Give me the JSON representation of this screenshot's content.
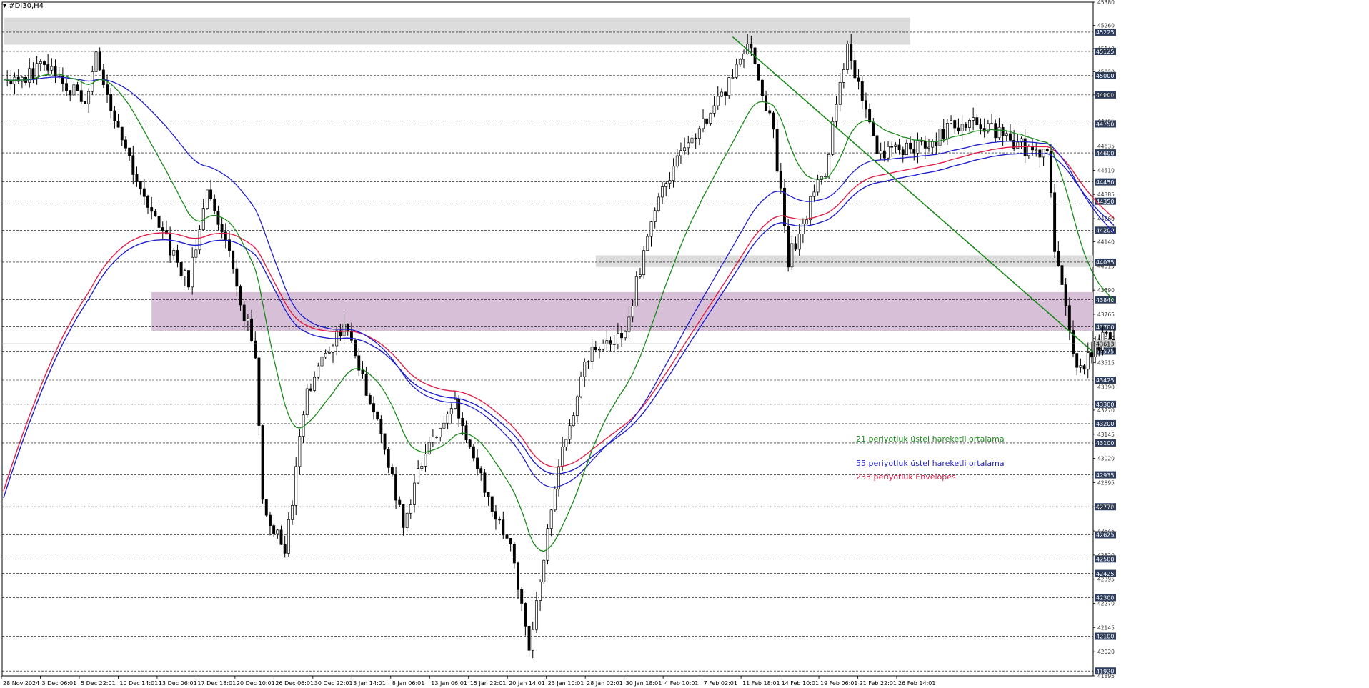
{
  "chart_data": {
    "type": "candlestick",
    "symbol_label": "#DJ30,H4",
    "current_price_label": "43613",
    "y_axis": {
      "min": 41895,
      "max": 45380,
      "tick_labels": [
        "45380",
        "45260",
        "45140",
        "45020",
        "44900",
        "44765",
        "44635",
        "44510",
        "44385",
        "44260",
        "44140",
        "44015",
        "43890",
        "43765",
        "43640",
        "43515",
        "43390",
        "43270",
        "43145",
        "43020",
        "42895",
        "42770",
        "42645",
        "42520",
        "42395",
        "42270",
        "42145",
        "42020",
        "41895"
      ]
    },
    "level_labels": [
      "45225",
      "45125",
      "45000",
      "44900",
      "44750",
      "44600",
      "44450",
      "44350",
      "44200",
      "44035",
      "43840",
      "43700",
      "43575",
      "43425",
      "43300",
      "43200",
      "43100",
      "42935",
      "42770",
      "42625",
      "42500",
      "42425",
      "42300",
      "42100",
      "41920"
    ],
    "x_axis": {
      "tick_labels": [
        "28 Nov 2024",
        "3 Dec 06:01",
        "5 Dec 22:01",
        "10 Dec 14:01",
        "13 Dec 06:01",
        "17 Dec 18:01",
        "20 Dec 10:01",
        "26 Dec 06:01",
        "30 Dec 22:01",
        "3 Jan 14:01",
        "8 Jan 06:01",
        "13 Jan 06:01",
        "15 Jan 22:01",
        "20 Jan 14:01",
        "23 Jan 10:01",
        "28 Jan 02:01",
        "30 Jan 18:01",
        "4 Feb 10:01",
        "7 Feb 02:01",
        "11 Feb 18:01",
        "14 Feb 10:01",
        "19 Feb 06:01",
        "21 Feb 22:01",
        "26 Feb 14:01"
      ]
    },
    "candle_count": 300,
    "price_path_anchors": [
      [
        0,
        44950
      ],
      [
        12,
        45060
      ],
      [
        22,
        44860
      ],
      [
        25,
        45120
      ],
      [
        30,
        44760
      ],
      [
        40,
        44300
      ],
      [
        50,
        43920
      ],
      [
        55,
        44450
      ],
      [
        60,
        44150
      ],
      [
        68,
        43550
      ],
      [
        70,
        42780
      ],
      [
        76,
        42520
      ],
      [
        82,
        43380
      ],
      [
        92,
        43700
      ],
      [
        100,
        43280
      ],
      [
        108,
        42700
      ],
      [
        115,
        43100
      ],
      [
        122,
        43300
      ],
      [
        130,
        42850
      ],
      [
        138,
        42500
      ],
      [
        142,
        42000
      ],
      [
        150,
        43000
      ],
      [
        158,
        43550
      ],
      [
        168,
        43700
      ],
      [
        178,
        44450
      ],
      [
        188,
        44700
      ],
      [
        202,
        45180
      ],
      [
        208,
        44700
      ],
      [
        212,
        44050
      ],
      [
        222,
        44520
      ],
      [
        228,
        45150
      ],
      [
        236,
        44600
      ],
      [
        250,
        44650
      ],
      [
        262,
        44800
      ],
      [
        272,
        44650
      ],
      [
        282,
        44600
      ],
      [
        284,
        44130
      ],
      [
        290,
        43480
      ],
      [
        298,
        43650
      ],
      [
        300,
        43613
      ]
    ],
    "zones": [
      {
        "y_top": 45300,
        "y_bottom": 45160,
        "x_start": 0,
        "x_end": 245,
        "color": "#dcdcdc"
      },
      {
        "y_top": 44070,
        "y_bottom": 44010,
        "x_start": 160,
        "x_end": 300,
        "color": "#dcdcdc"
      },
      {
        "y_top": 43880,
        "y_bottom": 43680,
        "x_start": 40,
        "x_end": 300,
        "color": "#d8bfd8"
      }
    ],
    "trendline": {
      "from": [
        197,
        45200
      ],
      "to": [
        333,
        43570
      ],
      "color": "#1a8a1a"
    },
    "series": [
      {
        "name": "21 periyotluk üstel hareketli ortalama",
        "color": "#1a8a1a",
        "type": "ema",
        "period": 21
      },
      {
        "name": "55 periyotluk üstel hareketli ortalama",
        "color": "#1f1fcc",
        "type": "ema",
        "period": 55
      },
      {
        "name": "233 periyotluk Envelopes",
        "color": "#e0204a",
        "type": "envelope",
        "period": 233
      }
    ],
    "bull_color": "#ffffff",
    "bear_color": "#000000"
  }
}
